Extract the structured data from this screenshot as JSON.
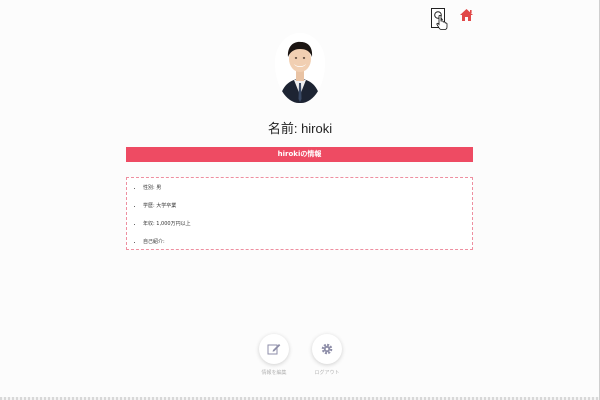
{
  "profile": {
    "name_heading": "名前: hiroki",
    "info_header": "hirokiの情報",
    "details": [
      "性別: 男",
      "学歴: 大学卒業",
      "年収: 1,000万円以上",
      "自己紹介:"
    ]
  },
  "actions": {
    "edit_label": "情報を編集",
    "logout_label": "ログアウト"
  },
  "icons": {
    "search": "search-icon",
    "cursor": "cursor-icon",
    "home": "home-icon",
    "edit": "edit-icon",
    "settings": "gear-icon"
  },
  "colors": {
    "accent": "#ee4b63",
    "home": "#e04848"
  }
}
